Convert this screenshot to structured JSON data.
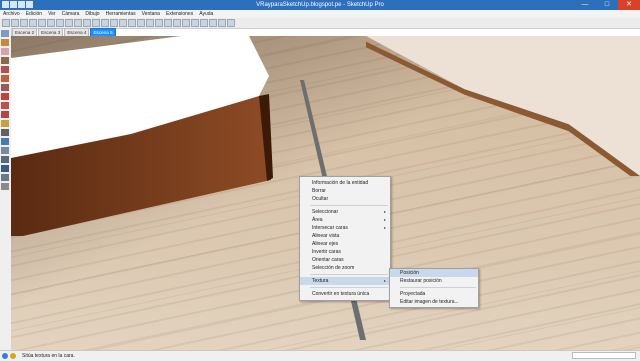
{
  "window": {
    "title": "VRayparaSketchUp.blogspot.pe - SketchUp Pro",
    "minimize_glyph": "—",
    "maximize_glyph": "□",
    "close_glyph": "✕"
  },
  "menubar": [
    "Archivo",
    "Edición",
    "Ver",
    "Cámara",
    "Dibujo",
    "Herramientas",
    "Ventana",
    "Extensiones",
    "Ayuda"
  ],
  "scene_tabs": [
    "Escena 2",
    "Escena 3",
    "Escena 4",
    "Escena 5"
  ],
  "active_scene_tab": "Escena 5",
  "context_menu": {
    "items": [
      "Información de la entidad",
      "Borrar",
      "Ocultar",
      "Seleccionar",
      "Área",
      "Intersecar caras",
      "Alinear vista",
      "Alinear ejes",
      "Invertir caras",
      "Orientar caras",
      "Selección de zoom",
      "Textura",
      "Convertir en textura única"
    ],
    "submenu_arrow": "▸",
    "highlighted": "Textura"
  },
  "texture_submenu": {
    "items": [
      "Posición",
      "Restaurar posición",
      "Proyectada",
      "Editar imagen de textura..."
    ],
    "highlighted": "Posición"
  },
  "status_bar": {
    "text": "Sitúa textura en la cara."
  },
  "icons": [
    "select-arrow-icon",
    "paint-bucket-icon",
    "eraser-icon",
    "line-icon",
    "rectangle-icon",
    "circle-icon",
    "push-pull-icon",
    "move-icon",
    "rotate-icon",
    "scale-icon",
    "tape-measure-icon",
    "text-icon",
    "orbit-icon",
    "pan-icon",
    "zoom-icon",
    "zoom-extents-icon"
  ],
  "colors": {
    "titlebar": "#2b6fbd",
    "active_tab": "#1e90ff",
    "menu_highlight": "#c9d9ec"
  }
}
